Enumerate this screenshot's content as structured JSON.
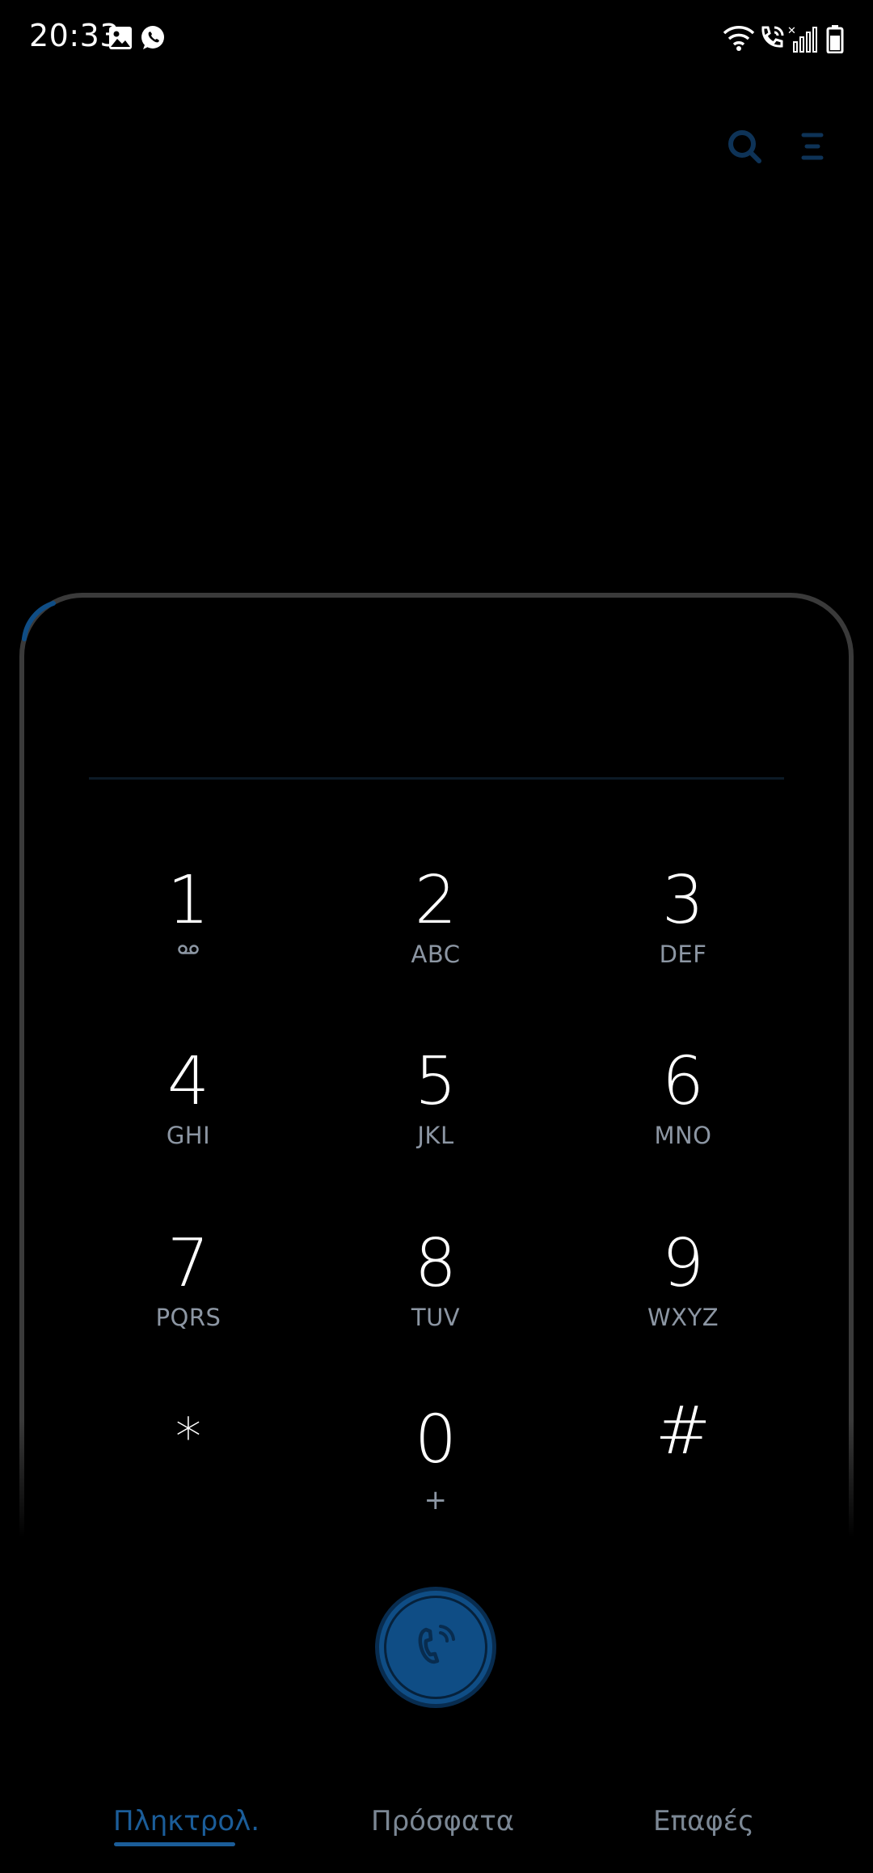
{
  "status_bar": {
    "time": "20:33",
    "left_icons": [
      "image-icon",
      "whatsapp-icon"
    ],
    "right_icons": [
      "wifi-icon",
      "wifi-calling-icon",
      "signal-no-service-icon",
      "battery-icon"
    ]
  },
  "toolbar": {
    "search_icon": "search-icon",
    "menu_icon": "more-vert-icon",
    "icon_color": "#0e3357"
  },
  "dialer": {
    "number": "",
    "keys": [
      {
        "digit": "1",
        "letters": "",
        "sub_icon": "voicemail-icon"
      },
      {
        "digit": "2",
        "letters": "ABC"
      },
      {
        "digit": "3",
        "letters": "DEF"
      },
      {
        "digit": "4",
        "letters": "GHI"
      },
      {
        "digit": "5",
        "letters": "JKL"
      },
      {
        "digit": "6",
        "letters": "MNO"
      },
      {
        "digit": "7",
        "letters": "PQRS"
      },
      {
        "digit": "8",
        "letters": "TUV"
      },
      {
        "digit": "9",
        "letters": "WXYZ"
      },
      {
        "digit": "*",
        "letters": ""
      },
      {
        "digit": "0",
        "letters": "+"
      },
      {
        "digit": "#",
        "letters": ""
      }
    ],
    "call_icon": "wifi-call-icon",
    "accent_color": "#0f4d85"
  },
  "bottom_nav": {
    "tabs": [
      {
        "label": "Πληκτρολ.",
        "active": true
      },
      {
        "label": "Πρόσφατα",
        "active": false
      },
      {
        "label": "Επαφές",
        "active": false
      }
    ],
    "active_color": "#1b5d99",
    "inactive_color": "#7b8794"
  }
}
